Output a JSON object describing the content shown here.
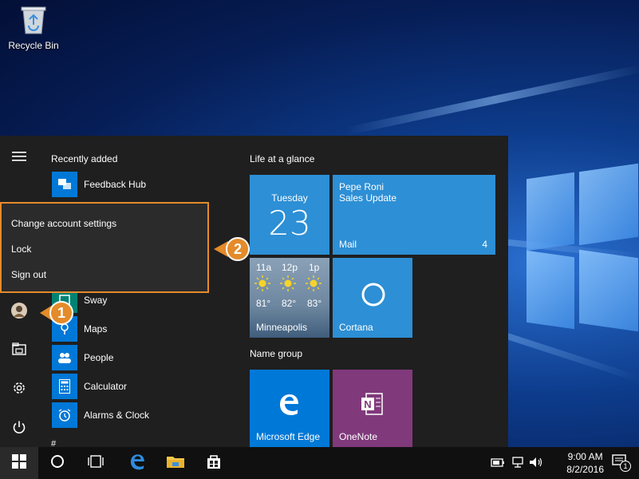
{
  "desktop": {
    "recycle_bin_label": "Recycle Bin"
  },
  "start_menu": {
    "recently_added_heading": "Recently added",
    "apps": [
      {
        "label": "Feedback Hub"
      },
      {
        "label": "Sway"
      },
      {
        "label": "Maps"
      },
      {
        "label": "People"
      },
      {
        "label": "Calculator"
      },
      {
        "label": "Alarms & Clock"
      }
    ],
    "hash_heading": "#",
    "group1_heading": "Life at a glance",
    "group2_heading": "Name group",
    "calendar_tile": {
      "day": "Tuesday",
      "date": "23"
    },
    "mail_tile": {
      "sender": "Pepe Roni",
      "subject": "Sales Update",
      "label": "Mail",
      "count": "4"
    },
    "weather_tile": {
      "hours": [
        "11a",
        "12p",
        "1p"
      ],
      "temps": [
        "81°",
        "82°",
        "83°"
      ],
      "city": "Minneapolis"
    },
    "cortana_tile": {
      "label": "Cortana"
    },
    "edge_tile": {
      "label": "Microsoft Edge"
    },
    "onenote_tile": {
      "label": "OneNote"
    }
  },
  "account_flyout": {
    "items": [
      "Change account settings",
      "Lock",
      "Sign out"
    ]
  },
  "callouts": [
    "1",
    "2"
  ],
  "taskbar": {
    "time": "9:00 AM",
    "date": "8/2/2016",
    "notification_count": "1"
  },
  "colors": {
    "accent": "#0078d7",
    "callout": "#e48b2a",
    "tile_blue": "#2d8fd5",
    "onenote": "#80397b",
    "start_bg": "#1f1f1f"
  }
}
